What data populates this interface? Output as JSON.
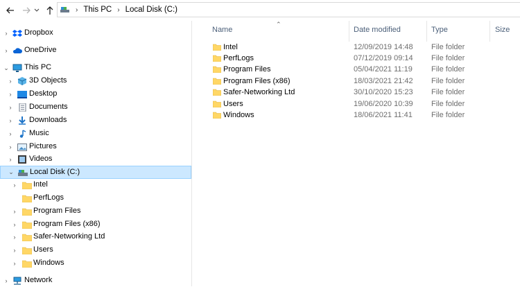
{
  "address": {
    "back_icon": "arrow-left-icon",
    "forward_icon": "arrow-right-icon",
    "recent_icon": "chevron-down-icon",
    "up_icon": "arrow-up-icon",
    "crumbs": [
      "This PC",
      "Local Disk (C:)"
    ]
  },
  "nav": {
    "items": [
      {
        "label": "Dropbox",
        "icon": "dropbox-icon"
      },
      {
        "label": "OneDrive",
        "icon": "cloud-icon"
      },
      {
        "label": "This PC",
        "icon": "computer-icon"
      },
      {
        "label": "3D Objects",
        "icon": "cube-icon"
      },
      {
        "label": "Desktop",
        "icon": "desktop-icon"
      },
      {
        "label": "Documents",
        "icon": "document-icon"
      },
      {
        "label": "Downloads",
        "icon": "download-icon"
      },
      {
        "label": "Music",
        "icon": "music-icon"
      },
      {
        "label": "Pictures",
        "icon": "picture-icon"
      },
      {
        "label": "Videos",
        "icon": "video-icon"
      },
      {
        "label": "Local Disk (C:)",
        "icon": "drive-icon"
      },
      {
        "label": "Intel",
        "icon": "folder-icon"
      },
      {
        "label": "PerfLogs",
        "icon": "folder-icon"
      },
      {
        "label": "Program Files",
        "icon": "folder-icon"
      },
      {
        "label": "Program Files (x86)",
        "icon": "folder-icon"
      },
      {
        "label": "Safer-Networking Ltd",
        "icon": "folder-icon"
      },
      {
        "label": "Users",
        "icon": "folder-icon"
      },
      {
        "label": "Windows",
        "icon": "folder-icon"
      },
      {
        "label": "Network",
        "icon": "network-icon"
      }
    ]
  },
  "columns": {
    "name": "Name",
    "date": "Date modified",
    "type": "Type",
    "size": "Size"
  },
  "files": [
    {
      "name": "Intel",
      "date": "12/09/2019 14:48",
      "type": "File folder"
    },
    {
      "name": "PerfLogs",
      "date": "07/12/2019 09:14",
      "type": "File folder"
    },
    {
      "name": "Program Files",
      "date": "05/04/2021 11:19",
      "type": "File folder"
    },
    {
      "name": "Program Files (x86)",
      "date": "18/03/2021 21:42",
      "type": "File folder"
    },
    {
      "name": "Safer-Networking Ltd",
      "date": "30/10/2020 15:23",
      "type": "File folder"
    },
    {
      "name": "Users",
      "date": "19/06/2020 10:39",
      "type": "File folder"
    },
    {
      "name": "Windows",
      "date": "18/06/2021 11:41",
      "type": "File folder"
    }
  ],
  "colors": {
    "selection": "#cce8ff",
    "selection_border": "#99d1ff",
    "folder": "#ffd766",
    "header_text": "#4c607a"
  }
}
